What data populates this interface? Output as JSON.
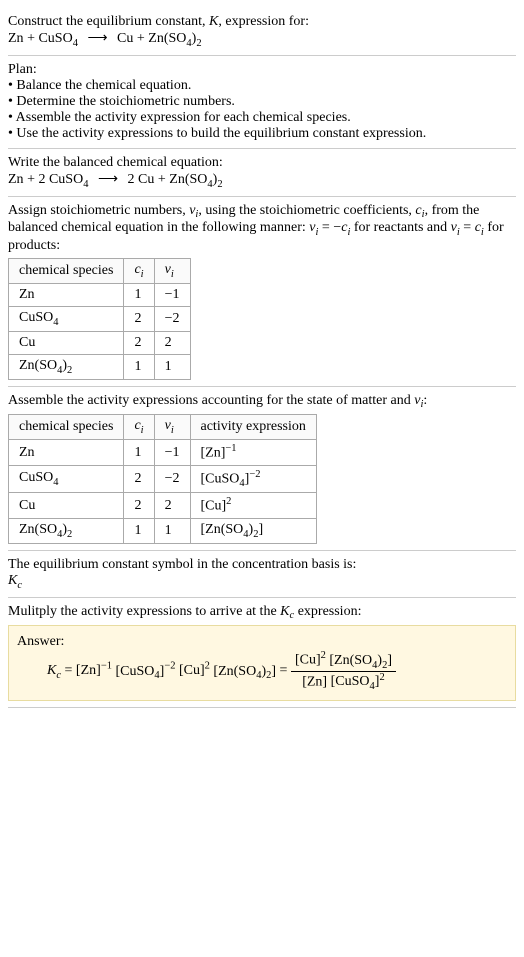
{
  "header": {
    "prompt": "Construct the equilibrium constant, ",
    "K": "K",
    "prompt2": ", expression for:",
    "eq_lhs1": "Zn",
    "plus": " + ",
    "eq_lhs2": "CuSO",
    "sub4": "4",
    "arrow": "⟶",
    "eq_rhs1": "Cu",
    "eq_rhs2": "Zn(SO",
    "sub4b": "4",
    "rparen": ")",
    "sub2": "2"
  },
  "plan": {
    "title": "Plan:",
    "b1": "• Balance the chemical equation.",
    "b2": "• Determine the stoichiometric numbers.",
    "b3": "• Assemble the activity expression for each chemical species.",
    "b4": "• Use the activity expressions to build the equilibrium constant expression."
  },
  "balanced": {
    "title": "Write the balanced chemical equation:",
    "s1": "Zn",
    "coef2": "2 ",
    "s2": "CuSO",
    "s3": "Cu",
    "s4": "Zn(SO"
  },
  "assign": {
    "p1": "Assign stoichiometric numbers, ",
    "nu": "ν",
    "i": "i",
    "p2": ", using the stoichiometric coefficients, ",
    "c": "c",
    "p3": ", from the balanced chemical equation in the following manner: ",
    "rel1a": " = −",
    "p4": " for reactants and ",
    "rel2a": " = ",
    "p5": " for products:",
    "table1": {
      "h1": "chemical species",
      "h2_c": "c",
      "h2_i": "i",
      "h3_nu": "ν",
      "h3_i": "i",
      "rows": [
        {
          "sp": "Zn",
          "c": "1",
          "nu": "−1"
        },
        {
          "sp": "CuSO4",
          "c": "2",
          "nu": "−2"
        },
        {
          "sp": "Cu",
          "c": "2",
          "nu": "2"
        },
        {
          "sp": "Zn(SO4)2",
          "c": "1",
          "nu": "1"
        }
      ]
    }
  },
  "assemble": {
    "p1": "Assemble the activity expressions accounting for the state of matter and ",
    "p2": ":",
    "table2": {
      "h1": "chemical species",
      "h4": "activity expression",
      "rows": [
        {
          "sp": "Zn",
          "c": "1",
          "nu": "−1",
          "act_base": "[Zn]",
          "act_exp": "−1"
        },
        {
          "sp": "CuSO4",
          "c": "2",
          "nu": "−2",
          "act_base": "[CuSO4]",
          "act_exp": "−2"
        },
        {
          "sp": "Cu",
          "c": "2",
          "nu": "2",
          "act_base": "[Cu]",
          "act_exp": "2"
        },
        {
          "sp": "Zn(SO4)2",
          "c": "1",
          "nu": "1",
          "act_base": "[Zn(SO4)2]",
          "act_exp": ""
        }
      ]
    }
  },
  "symbol": {
    "p1": "The equilibrium constant symbol in the concentration basis is:",
    "Kc_K": "K",
    "Kc_c": "c"
  },
  "multiply": {
    "p1": "Mulitply the activity expressions to arrive at the ",
    "p2": " expression:"
  },
  "answer": {
    "label": "Answer:",
    "eq": " = ",
    "t1": "[Zn]",
    "e1": "−1",
    "t2": "[CuSO",
    "t2b": "]",
    "e2": "−2",
    "t3": "[Cu]",
    "e3": "2",
    "t4": "[Zn(SO",
    "t4b": ")",
    "t4c": "]",
    "num1": "[Cu]",
    "num2": "[Zn(SO",
    "den1": "[Zn]",
    "den2": "[CuSO"
  }
}
